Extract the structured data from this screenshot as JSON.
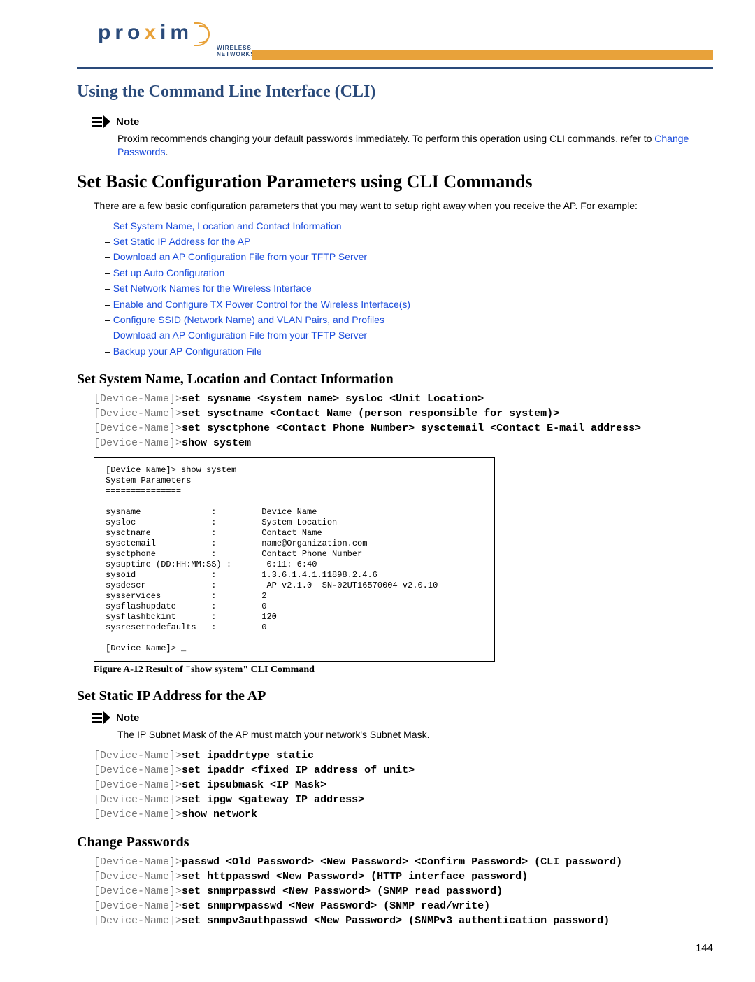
{
  "logo": {
    "tagline": "WIRELESS NETWORKS"
  },
  "section_title": "Using the Command Line Interface (CLI)",
  "note1": {
    "label": "Note",
    "body_pre": "Proxim recommends changing your default passwords immediately. To perform this operation using CLI commands, refer to ",
    "body_link": "Change Passwords",
    "body_post": "."
  },
  "main_heading": "Set Basic Configuration Parameters using CLI Commands",
  "intro": "There are a few basic configuration parameters that you may want to setup right away when you receive the AP. For example:",
  "links": [
    "Set System Name, Location and Contact Information",
    "Set Static IP Address for the AP",
    "Download an AP Configuration File from your TFTP Server",
    "Set up Auto Configuration",
    "Set Network Names for the Wireless Interface",
    "Enable and Configure TX Power Control for the Wireless Interface(s)",
    "Configure SSID (Network Name) and VLAN Pairs, and Profiles",
    "Download an AP Configuration File from your TFTP Server",
    "Backup your AP Configuration File"
  ],
  "sec_sysname": {
    "title": "Set System Name, Location and Contact Information",
    "cmds": [
      {
        "prompt": "[Device-Name]>",
        "text": "set sysname <system name> sysloc <Unit Location>"
      },
      {
        "prompt": "[Device-Name]>",
        "text": "set sysctname <Contact Name (person responsible for system)>"
      },
      {
        "prompt": "[Device-Name]>",
        "text": "set sysctphone <Contact Phone Number> sysctemail <Contact E-mail address>"
      },
      {
        "prompt": "[Device-Name]>",
        "text": "show system"
      }
    ]
  },
  "terminal": "[Device Name]> show system\nSystem Parameters\n===============\n\nsysname              :         Device Name\nsysloc               :         System Location\nsysctname            :         Contact Name\nsysctemail           :         name@Organization.com\nsysctphone           :         Contact Phone Number\nsysuptime (DD:HH:MM:SS) :       0:11: 6:40\nsysoid               :         1.3.6.1.4.1.11898.2.4.6\nsysdescr             :          AP v2.1.0  SN-02UT16570004 v2.0.10\nsysservices          :         2\nsysflashupdate       :         0\nsysflashbckint       :         120\nsysresettodefaults   :         0\n\n[Device Name]> _",
  "fig_caption": "Figure A-12   Result of \"show system\" CLI Command",
  "sec_static": {
    "title": "Set Static IP Address for the AP",
    "note_label": "Note",
    "note_body": "The IP Subnet Mask of the AP must match your network's Subnet Mask.",
    "cmds": [
      {
        "prompt": "[Device-Name]>",
        "text": "set ipaddrtype static"
      },
      {
        "prompt": "[Device-Name]>",
        "text": "set ipaddr <fixed IP address of unit>"
      },
      {
        "prompt": "[Device-Name]>",
        "text": "set ipsubmask <IP Mask>"
      },
      {
        "prompt": "[Device-Name]>",
        "text": "set ipgw <gateway IP address>"
      },
      {
        "prompt": "[Device-Name]>",
        "text": "show network"
      }
    ]
  },
  "sec_pw": {
    "title": "Change Passwords",
    "cmds": [
      {
        "prompt": "[Device-Name]>",
        "text": "passwd <Old Password> <New Password> <Confirm Password> (CLI password)"
      },
      {
        "prompt": "[Device-Name]>",
        "text": "set httppasswd <New Password> (HTTP interface password)"
      },
      {
        "prompt": "[Device-Name]>",
        "text": "set snmprpasswd <New Password> (SNMP read password)"
      },
      {
        "prompt": "[Device-Name]>",
        "text": "set snmprwpasswd <New Password> (SNMP read/write)"
      },
      {
        "prompt": "[Device-Name]>",
        "text": "set snmpv3authpasswd <New Password> (SNMPv3 authentication password)"
      }
    ]
  },
  "page_number": "144"
}
